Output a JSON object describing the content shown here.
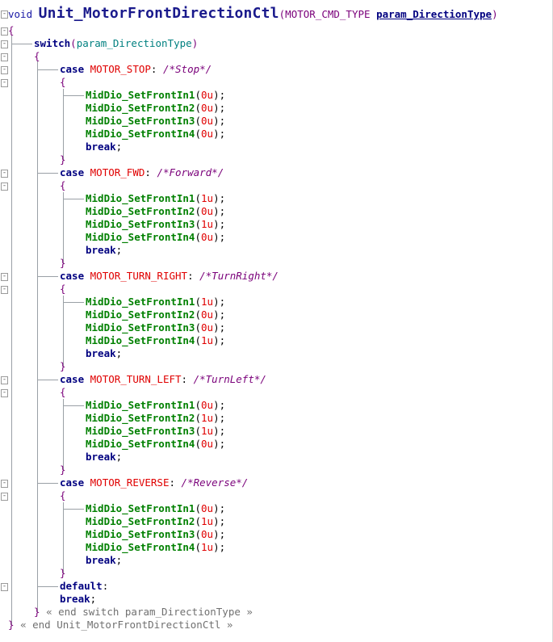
{
  "editor": {
    "header": {
      "void": "void",
      "func": "Unit_MotorFrontDirectionCtl",
      "paren_open": "(",
      "ptype": "MOTOR_CMD_TYPE",
      "pname": "param_DirectionType",
      "paren_close": ")"
    },
    "brace_open": "{",
    "brace_close": "}",
    "switch_line": {
      "kw": "switch",
      "paren_open": "(",
      "arg": "param_DirectionType",
      "paren_close": ")"
    },
    "break_kw": "break",
    "semicolon": ";",
    "colon": ":",
    "cases": [
      {
        "kw": "case",
        "label": "MOTOR_STOP",
        "comment": "/*Stop*/",
        "calls": [
          {
            "fn": "MidDio_SetFrontIn1",
            "arg": "0u"
          },
          {
            "fn": "MidDio_SetFrontIn2",
            "arg": "0u"
          },
          {
            "fn": "MidDio_SetFrontIn3",
            "arg": "0u"
          },
          {
            "fn": "MidDio_SetFrontIn4",
            "arg": "0u"
          }
        ]
      },
      {
        "kw": "case",
        "label": "MOTOR_FWD",
        "comment": "/*Forward*/",
        "calls": [
          {
            "fn": "MidDio_SetFrontIn1",
            "arg": "1u"
          },
          {
            "fn": "MidDio_SetFrontIn2",
            "arg": "0u"
          },
          {
            "fn": "MidDio_SetFrontIn3",
            "arg": "1u"
          },
          {
            "fn": "MidDio_SetFrontIn4",
            "arg": "0u"
          }
        ]
      },
      {
        "kw": "case",
        "label": "MOTOR_TURN_RIGHT",
        "comment": "/*TurnRight*/",
        "calls": [
          {
            "fn": "MidDio_SetFrontIn1",
            "arg": "1u"
          },
          {
            "fn": "MidDio_SetFrontIn2",
            "arg": "0u"
          },
          {
            "fn": "MidDio_SetFrontIn3",
            "arg": "0u"
          },
          {
            "fn": "MidDio_SetFrontIn4",
            "arg": "1u"
          }
        ]
      },
      {
        "kw": "case",
        "label": "MOTOR_TURN_LEFT",
        "comment": "/*TurnLeft*/",
        "calls": [
          {
            "fn": "MidDio_SetFrontIn1",
            "arg": "0u"
          },
          {
            "fn": "MidDio_SetFrontIn2",
            "arg": "1u"
          },
          {
            "fn": "MidDio_SetFrontIn3",
            "arg": "1u"
          },
          {
            "fn": "MidDio_SetFrontIn4",
            "arg": "0u"
          }
        ]
      },
      {
        "kw": "case",
        "label": "MOTOR_REVERSE",
        "comment": "/*Reverse*/",
        "calls": [
          {
            "fn": "MidDio_SetFrontIn1",
            "arg": "0u"
          },
          {
            "fn": "MidDio_SetFrontIn2",
            "arg": "1u"
          },
          {
            "fn": "MidDio_SetFrontIn3",
            "arg": "0u"
          },
          {
            "fn": "MidDio_SetFrontIn4",
            "arg": "1u"
          }
        ]
      }
    ],
    "default_kw": "default",
    "end_switch_comment": "« end switch param_DirectionType »",
    "end_func_comment": "« end Unit_MotorFrontDirectionCtl »",
    "fold_glyph": "-"
  }
}
